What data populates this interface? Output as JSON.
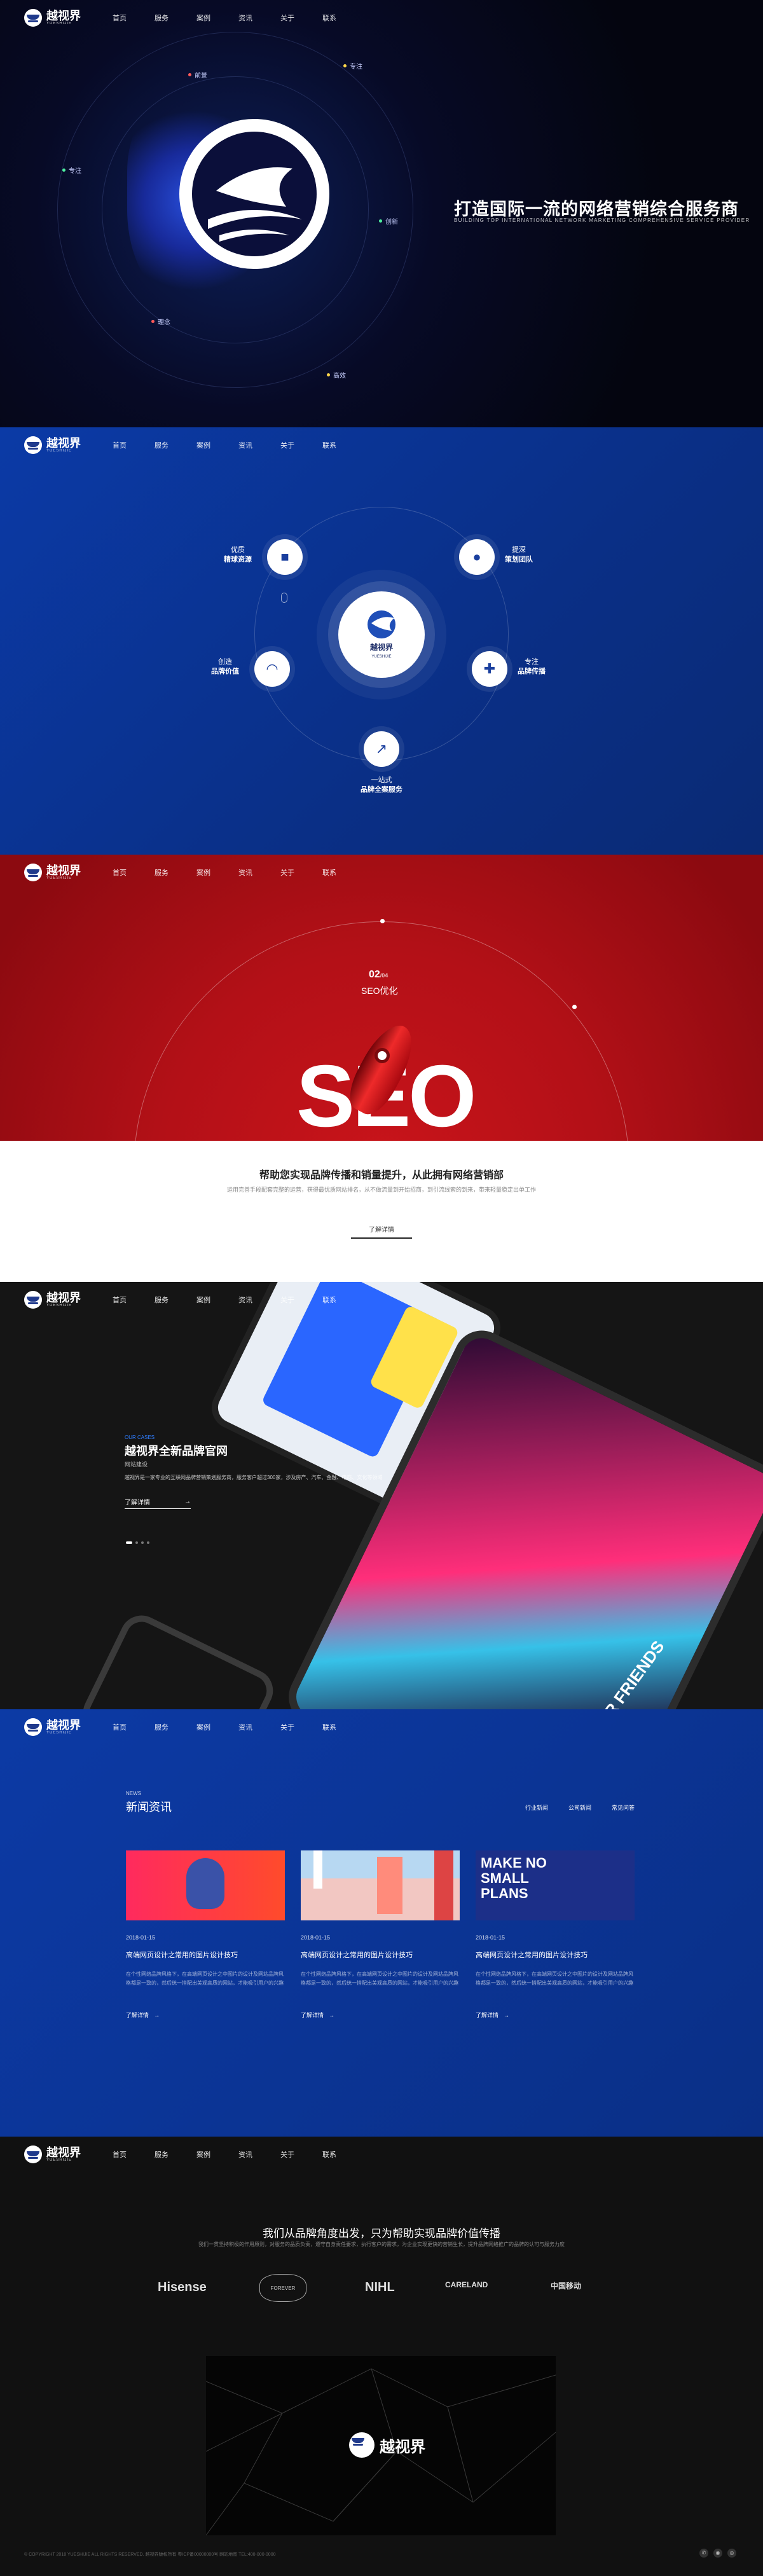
{
  "nav": {
    "logo_text": "越视界",
    "logo_sub": "YUESHIJIE",
    "items": [
      "首页",
      "服务",
      "案例",
      "资讯",
      "关于",
      "联系"
    ]
  },
  "hero": {
    "title": "打造国际一流的网络营销综合服务商",
    "subtitle": "BUILDING TOP INTERNATIONAL NETWORK MARKETING COMPREHENSIVE SERVICE PROVIDER",
    "orbit_labels": [
      "前景",
      "专注",
      "专注",
      "创新",
      "理念",
      "高效"
    ]
  },
  "services": {
    "nodes": [
      {
        "top": "优质",
        "bold": "精球资源"
      },
      {
        "top": "提深",
        "bold": "策划团队"
      },
      {
        "top": "创造",
        "bold": "品牌价值"
      },
      {
        "top": "专注",
        "bold": "品牌传播"
      },
      {
        "top": "一站式",
        "bold": "品牌全案服务"
      }
    ],
    "center_text": "越视界",
    "center_sub": "YUESHIJIE"
  },
  "seo": {
    "number": "02",
    "unit": "/04",
    "label": "SEO优化",
    "big_text": "SEO",
    "headline": "帮助您实现品牌传播和销量提升，从此拥有网络营销部",
    "desc": "运用完善手段配套完整的运营，获得最优质网站排名，从不做流量到开始招商，到引流线索的到来，带来轻量稳定出单工作",
    "button": "了解详情"
  },
  "case": {
    "eyebrow": "OUR CASES",
    "title": "越视界全新品牌官网",
    "tag": "网站建设",
    "desc": "越视界是一家专业的互联网品牌营销策划服务商，服务客户超过300家，涉及房产、汽车、金融、电商、文化等领域",
    "button": "了解详情",
    "tablet_text": "TOKEN FOR FRIENDS"
  },
  "news": {
    "eyebrow": "NEWS",
    "title": "新闻资讯",
    "tabs": [
      "行业新闻",
      "公司新闻",
      "常见问答"
    ],
    "cards": [
      {
        "date": "2018-01-15",
        "title": "高端网页设计之常用的图片设计技巧",
        "desc": "在个性网络品牌风格下，在高端网页设计之中图片的设计及网站品牌风格都是一致的，然后统一搭配出美观高质的网站，才能吸引用户的兴趣",
        "more": "了解详情",
        "img_text": ""
      },
      {
        "date": "2018-01-15",
        "title": "高端网页设计之常用的图片设计技巧",
        "desc": "在个性网络品牌风格下，在高端网页设计之中图片的设计及网站品牌风格都是一致的，然后统一搭配出美观高质的网站，才能吸引用户的兴趣",
        "more": "了解详情",
        "img_text": ""
      },
      {
        "date": "2018-01-15",
        "title": "高端网页设计之常用的图片设计技巧",
        "desc": "在个性网络品牌风格下，在高端网页设计之中图片的设计及网站品牌风格都是一致的，然后统一搭配出美观高质的网站，才能吸引用户的兴趣",
        "more": "了解详情",
        "img_text": "MAKE NO SMALL PLANS"
      }
    ]
  },
  "partners": {
    "title": "我们从品牌角度出发，只为帮助实现品牌价值传播",
    "desc": "我们一贯坚持积极的作用原则，对服务的品质负责，遵守自身责任要求，执行客户的需求，为企业实现更快的营销生长，提升品牌网络推广的品牌的认可与服务力度",
    "brands": [
      "Hisense",
      "FOREVER",
      "NIHL",
      "CARELAND",
      "中国移动"
    ],
    "video_text": "越视界",
    "footer": "© COPYRIGHT 2018 YUESHIJIE ALL RIGHTS RESERVED. 越视界版权所有 粤ICP备00000000号 网站地图 TEL:400-000-0000"
  }
}
